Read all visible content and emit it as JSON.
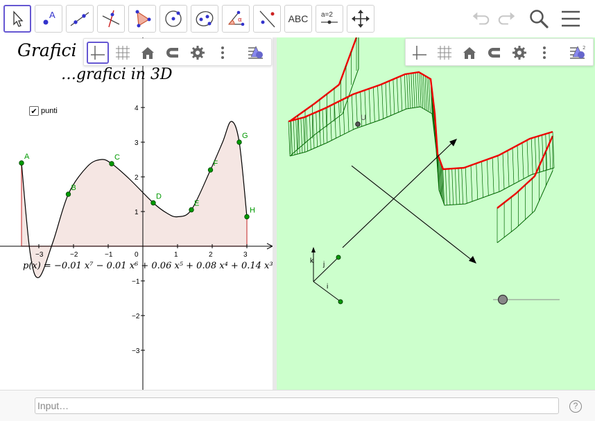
{
  "toolbar": {
    "tools": [
      {
        "name": "move-tool",
        "icon": "cursor-arrow-icon",
        "active": true
      },
      {
        "name": "point-tool",
        "icon": "point-icon",
        "label": "A"
      },
      {
        "name": "line-tool",
        "icon": "line-through-points-icon"
      },
      {
        "name": "perpendicular-line-tool",
        "icon": "perpendicular-line-icon"
      },
      {
        "name": "polygon-tool",
        "icon": "polygon-icon"
      },
      {
        "name": "circle-tool",
        "icon": "circle-center-point-icon"
      },
      {
        "name": "conic-tool",
        "icon": "ellipse-icon"
      },
      {
        "name": "angle-tool",
        "icon": "angle-icon",
        "label": "α"
      },
      {
        "name": "reflect-tool",
        "icon": "reflect-line-icon"
      },
      {
        "name": "text-tool",
        "icon": "text-icon",
        "label": "ABC"
      },
      {
        "name": "slider-tool",
        "icon": "slider-icon",
        "label": "a=2"
      },
      {
        "name": "move-view-tool",
        "icon": "move-graphics-view-icon"
      }
    ],
    "undo_icon": "undo-icon",
    "redo_icon": "redo-icon",
    "search_icon": "search-icon",
    "menu_icon": "hamburger-menu-icon"
  },
  "view2d": {
    "title1": "Grafici",
    "title2": "…grafici in 3D",
    "checkbox_label": "punti",
    "checkbox_checked": true,
    "polynomial": "p(x) = −0.01 x⁷ − 0.01 x⁶ + 0.06 x⁵ + 0.08 x⁴ + 0.14 x³",
    "x_ticks": [
      "−3",
      "−2",
      "−1",
      "0",
      "1",
      "2",
      "3"
    ],
    "y_ticks": [
      "4",
      "3",
      "2",
      "1",
      "−1",
      "−2",
      "−3"
    ],
    "points": [
      {
        "label": "A",
        "x": -3.5,
        "y": 2.4
      },
      {
        "label": "B",
        "x": -2.15,
        "y": 1.5
      },
      {
        "label": "C",
        "x": -0.9,
        "y": 2.38
      },
      {
        "label": "D",
        "x": 0.3,
        "y": 1.25
      },
      {
        "label": "E",
        "x": 1.4,
        "y": 1.05
      },
      {
        "label": "F",
        "x": 1.95,
        "y": 2.2
      },
      {
        "label": "G",
        "x": 2.78,
        "y": 3.0
      },
      {
        "label": "H",
        "x": 3.0,
        "y": 0.85
      }
    ],
    "stylebar_icons": [
      "axes-icon",
      "grid-icon",
      "home-icon",
      "magnet-icon",
      "gear-icon",
      "more-vertical-icon",
      "view-toggle-icon"
    ]
  },
  "view3d": {
    "point_label": "U",
    "axis_labels": {
      "i": "i",
      "j": "j",
      "k": "k"
    },
    "stylebar_icons": [
      "axes-icon",
      "grid-icon",
      "home-icon",
      "magnet-icon",
      "gear-icon",
      "more-vertical-icon",
      "view-toggle-icon"
    ],
    "stylebar_badge": "2"
  },
  "input": {
    "placeholder": "Input…",
    "help_icon": "help-icon",
    "help_glyph": "?"
  },
  "colors": {
    "accent": "#6557d2",
    "curve_red": "#ee0000",
    "mesh_green": "#006600",
    "point_green": "#009900",
    "area_fill": "#f5e6e3",
    "view3d_bg": "#ccffcc"
  }
}
